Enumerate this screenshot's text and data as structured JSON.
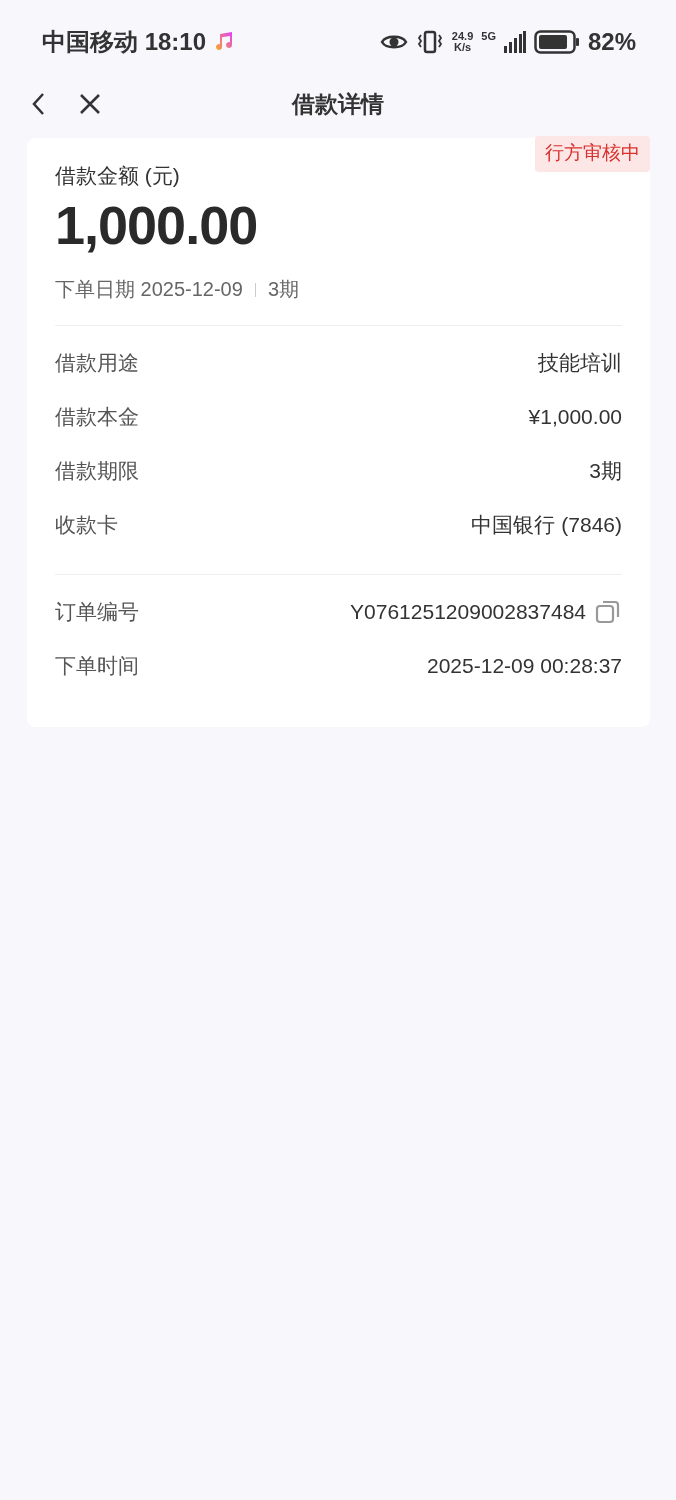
{
  "status_bar": {
    "carrier_time": "中国移动 18:10",
    "net_speed": "24.9",
    "net_unit": "K/s",
    "network": "5G",
    "battery": "82%"
  },
  "nav": {
    "title": "借款详情"
  },
  "card": {
    "badge": "行方审核中",
    "amount_label": "借款金额 (元)",
    "amount": "1,000.00",
    "date_label": "下单日期 2025-12-09",
    "terms": "3期",
    "groups": [
      {
        "rows": [
          {
            "kind": "plain",
            "label": "借款用途",
            "value": "技能培训"
          },
          {
            "kind": "plain",
            "label": "借款本金",
            "value": "¥1,000.00"
          },
          {
            "kind": "plain",
            "label": "借款期限",
            "value": "3期"
          },
          {
            "kind": "plain",
            "label": "收款卡",
            "value": "中国银行 (7846)"
          }
        ]
      },
      {
        "rows": [
          {
            "kind": "copy",
            "label": "订单编号",
            "value": "Y0761251209002837484"
          },
          {
            "kind": "plain",
            "label": "下单时间",
            "value": "2025-12-09 00:28:37"
          }
        ]
      }
    ]
  }
}
